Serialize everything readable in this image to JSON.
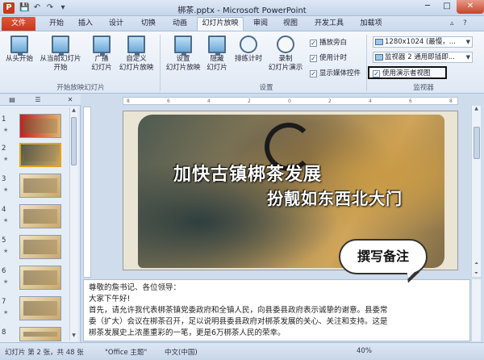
{
  "window": {
    "title": "梆茶.pptx - Microsoft PowerPoint",
    "minimize": "─",
    "maximize": "□",
    "close": "✕"
  },
  "quick_access": {
    "save": "💾",
    "undo": "↶",
    "redo": "↷",
    "more": "▾"
  },
  "tabs": {
    "file": "文件",
    "items": [
      "开始",
      "插入",
      "设计",
      "切换",
      "动画",
      "幻灯片放映",
      "审阅",
      "视图",
      "开发工具",
      "加载项"
    ],
    "active": "幻灯片放映"
  },
  "ribbon": {
    "start_group": {
      "from_beginning": "从头开始",
      "from_current_1": "从当前幻灯片",
      "from_current_2": "开始",
      "broadcast_1": "广播",
      "broadcast_2": "幻灯片",
      "custom_1": "自定义",
      "custom_2": "幻灯片放映",
      "label": "开始放映幻灯片"
    },
    "setup_group": {
      "setup_1": "设置",
      "setup_2": "幻灯片放映",
      "hide_1": "隐藏",
      "hide_2": "幻灯片",
      "rehearse": "排练计时",
      "record_1": "录制",
      "record_2": "幻灯片演示",
      "chk_narration": "播放旁白",
      "chk_timing": "使用计时",
      "chk_media": "显示媒体控件",
      "label": "设置"
    },
    "monitors_group": {
      "resolution": "1280x1024 (最慢，...",
      "monitor": "监视器 2  通用即插即...",
      "presenter_view": "使用演示者视图",
      "label": "监视器"
    }
  },
  "panel": {
    "tab_slides": "▤",
    "tab_outline": "☰",
    "close": "✕",
    "slides": [
      "1",
      "2",
      "3",
      "4",
      "5",
      "6",
      "7",
      "8"
    ],
    "selected": 2
  },
  "ruler": {
    "h_ticks": [
      "8",
      "6",
      "4",
      "2",
      "0",
      "2",
      "4",
      "6",
      "8"
    ]
  },
  "slide": {
    "title": "加快古镇梆茶发展",
    "subtitle": "扮靓如东西北大门"
  },
  "callout": "撰写备注",
  "notes": {
    "line1": "尊敬的詹书记、各位领导：",
    "line2": "大家下午好!",
    "line3": "首先，请允许我代表梆茶镇党委政府和全镇人民，向县委县政府表示诚挚的谢意。县委常",
    "line4": "委（扩大）会议在梆茶召开，足以说明县委县政府对梆茶发展的关心、关注和支持。这是",
    "line5": "梆茶发展史上浓墨重彩的一笔，更是6万梆茶人民的荣幸。"
  },
  "status": {
    "slide_info": "幻灯片 第 2 张，共 48 张",
    "theme": "\"Office 主题\"",
    "language": "中文(中国)",
    "zoom": "40%"
  }
}
